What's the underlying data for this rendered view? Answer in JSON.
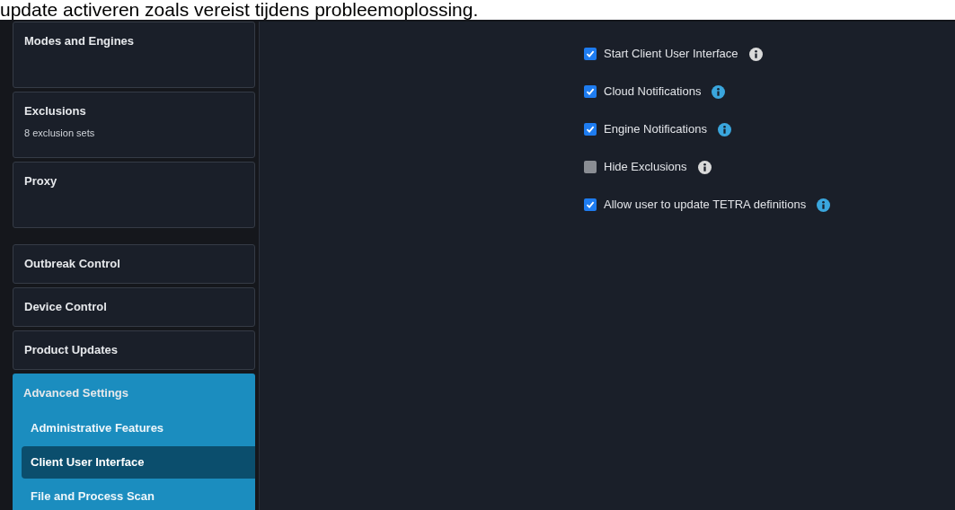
{
  "caption": "update activeren zoals vereist tijdens probleemoplossing.",
  "sidebar": {
    "groups": [
      {
        "items": [
          {
            "title": "Modes and Engines",
            "expanded": false
          },
          {
            "title": "Exclusions",
            "subtitle": "8 exclusion sets",
            "expanded": false
          },
          {
            "title": "Proxy",
            "expanded": false
          }
        ]
      },
      {
        "items": [
          {
            "title": "Outbreak Control",
            "expanded": false
          },
          {
            "title": "Device Control",
            "expanded": false
          },
          {
            "title": "Product Updates",
            "expanded": false
          },
          {
            "title": "Advanced Settings",
            "expanded": true,
            "children": [
              {
                "label": "Administrative Features",
                "selected": false
              },
              {
                "label": "Client User Interface",
                "selected": true
              },
              {
                "label": "File and Process Scan",
                "selected": false
              }
            ]
          }
        ]
      }
    ]
  },
  "options": [
    {
      "label": "Start Client User Interface",
      "checked": true,
      "color": "#d9d9d9"
    },
    {
      "label": "Cloud Notifications",
      "checked": true,
      "color": "#3aa6dd"
    },
    {
      "label": "Engine Notifications",
      "checked": true,
      "color": "#3aa6dd"
    },
    {
      "label": "Hide Exclusions",
      "checked": false,
      "color": "#d9d9d9"
    },
    {
      "label": "Allow user to update TETRA definitions",
      "checked": true,
      "color": "#3aa6dd"
    }
  ]
}
